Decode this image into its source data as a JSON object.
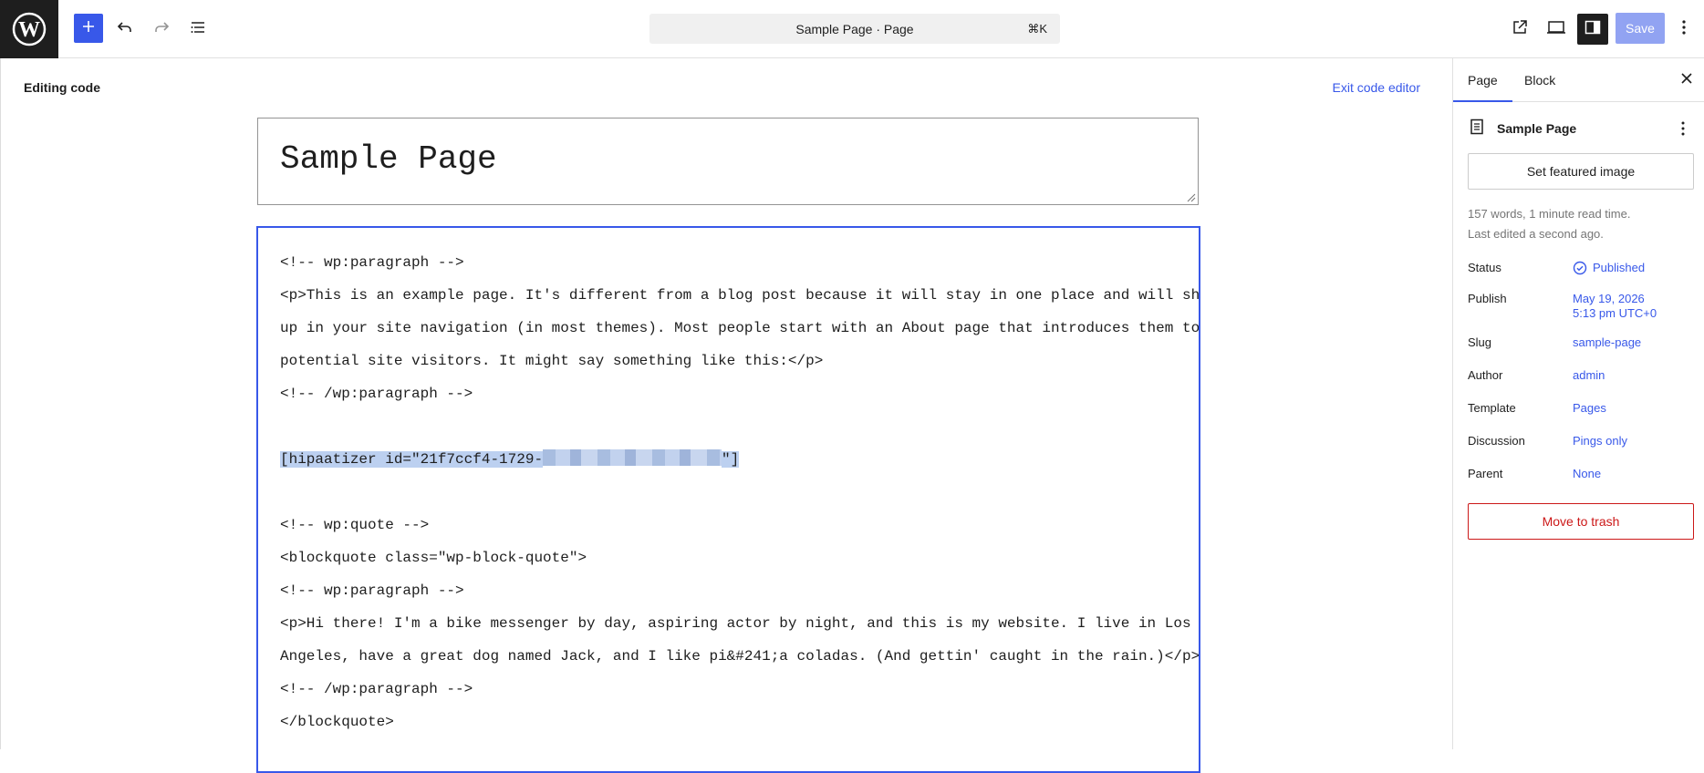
{
  "topbar": {
    "doc_title": "Sample Page · Page",
    "shortcut": "⌘K",
    "save_label": "Save"
  },
  "editor": {
    "mode_label": "Editing code",
    "exit_label": "Exit code editor",
    "post_title": "Sample Page",
    "code_lines": [
      "<!-- wp:paragraph -->",
      "<p>This is an example page. It's different from a blog post because it will stay in one place and will show",
      "up in your site navigation (in most themes). Most people start with an About page that introduces them to",
      "potential site visitors. It might say something like this:</p>",
      "<!-- /wp:paragraph -->",
      "",
      "[hipaatizer id=\"21f7ccf4-1729-",
      "",
      "<!-- wp:quote -->",
      "<blockquote class=\"wp-block-quote\">",
      "<!-- wp:paragraph -->",
      "<p>Hi there! I'm a bike messenger by day, aspiring actor by night, and this is my website. I live in Los",
      "Angeles, have a great dog named Jack, and I like pi&#241;a coladas. (And gettin' caught in the rain.)</p>",
      "<!-- /wp:paragraph -->",
      "</blockquote>"
    ],
    "shortcode_suffix": "\"]"
  },
  "sidebar": {
    "tabs": [
      "Page",
      "Block"
    ],
    "page_name": "Sample Page",
    "featured_label": "Set featured image",
    "meta_words": "157 words, 1 minute read time.",
    "meta_edited": "Last edited a second ago.",
    "rows": [
      {
        "label": "Status",
        "value": "Published"
      },
      {
        "label": "Publish",
        "value": "May 19, 2026",
        "value2": "5:13 pm UTC+0"
      },
      {
        "label": "Slug",
        "value": "sample-page"
      },
      {
        "label": "Author",
        "value": "admin"
      },
      {
        "label": "Template",
        "value": "Pages"
      },
      {
        "label": "Discussion",
        "value": "Pings only"
      },
      {
        "label": "Parent",
        "value": "None"
      }
    ],
    "trash_label": "Move to trash"
  },
  "colors": {
    "accent": "#3858e9",
    "danger": "#cc1818",
    "dark": "#1e1e1e"
  },
  "icons": [
    "wordpress-logo-icon",
    "plus-icon",
    "undo-icon",
    "redo-icon",
    "list-view-icon",
    "external-link-icon",
    "device-preview-icon",
    "settings-sidebar-icon",
    "more-vertical-icon",
    "close-icon",
    "page-icon",
    "published-check-icon"
  ]
}
